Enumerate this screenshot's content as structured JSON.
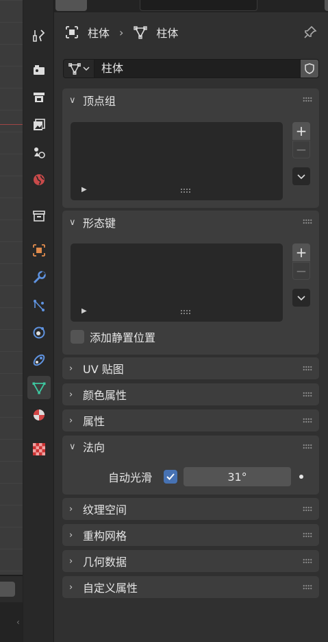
{
  "breadcrumb": {
    "object_name": "柱体",
    "mesh_name": "柱体",
    "separator": "›"
  },
  "datablock": {
    "name": "柱体"
  },
  "sections": {
    "vertex_groups": {
      "title": "顶点组",
      "expanded": true
    },
    "shape_keys": {
      "title": "形态键",
      "expanded": true,
      "relative_label": "添加静置位置",
      "relative_checked": false
    },
    "uv_maps": {
      "title": "UV 贴图",
      "expanded": false
    },
    "color_attributes": {
      "title": "颜色属性",
      "expanded": false
    },
    "attributes": {
      "title": "属性",
      "expanded": false
    },
    "normals": {
      "title": "法向",
      "expanded": true,
      "auto_smooth_label": "自动光滑",
      "auto_smooth_checked": true,
      "angle_value": "31°"
    },
    "texture_space": {
      "title": "纹理空间",
      "expanded": false
    },
    "remesh": {
      "title": "重构网格",
      "expanded": false
    },
    "geometry_data": {
      "title": "几何数据",
      "expanded": false
    },
    "custom_properties": {
      "title": "自定义属性",
      "expanded": false
    }
  },
  "icons": {
    "expanded_arrow": "∨",
    "collapsed_arrow": "›",
    "add": "+",
    "remove": "−",
    "menu": "∨",
    "play": "▶"
  },
  "tabs": [
    "tool-icon",
    "render-icon",
    "output-icon",
    "view-layer-icon",
    "scene-icon",
    "world-icon",
    "collection-icon",
    "object-icon",
    "modifier-icon",
    "particles-icon",
    "physics-icon",
    "constraints-icon",
    "mesh-data-icon",
    "material-icon",
    "texture-icon"
  ],
  "colors": {
    "accent": "#4772b3",
    "active_tab_icon": "#3ec7a0",
    "object_icon": "#e08b4c",
    "blue_icons": "#5f93e0",
    "material_icon": "#d24545"
  }
}
